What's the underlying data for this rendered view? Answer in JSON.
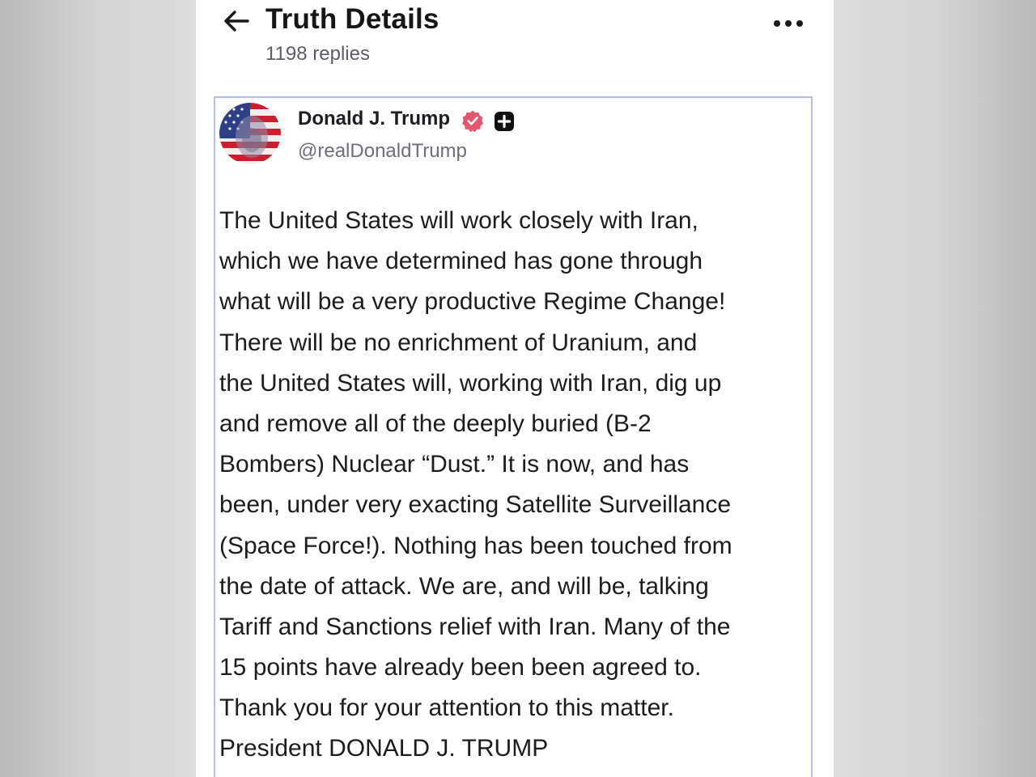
{
  "header": {
    "title": "Truth Details",
    "replies": "1198 replies",
    "back_icon": "arrow-left-icon",
    "more_icon": "more-horizontal-icon"
  },
  "post": {
    "author": {
      "name": "Donald J. Trump",
      "handle": "@realDonaldTrump",
      "avatar_icon": "flag-portrait-avatar",
      "verified_icon": "verified-badge-icon",
      "plus_icon": "plus-badge-icon"
    },
    "body_lines": [
      "The United States will work closely with Iran,",
      "which we have determined has gone through",
      "what will be a very productive Regime Change!",
      "There will be no enrichment of Uranium, and",
      "the United States will, working with Iran, dig up",
      "and remove all of the deeply buried (B-2",
      "Bombers) Nuclear “Dust.” It is now, and has",
      "been, under very exacting Satellite Surveillance",
      "(Space Force!). Nothing has been touched from",
      "the date of attack. We are, and will be, talking",
      "Tariff and Sanctions relief with Iran. Many of the",
      "15 points have already been been agreed to.",
      "Thank you for your attention to this matter.",
      "President DONALD J. TRUMP"
    ]
  },
  "colors": {
    "post_border": "#b8bfe6",
    "verified_badge": "#e2566e",
    "reply_text": "#5c5c66",
    "handle_text": "#6e6e78"
  }
}
